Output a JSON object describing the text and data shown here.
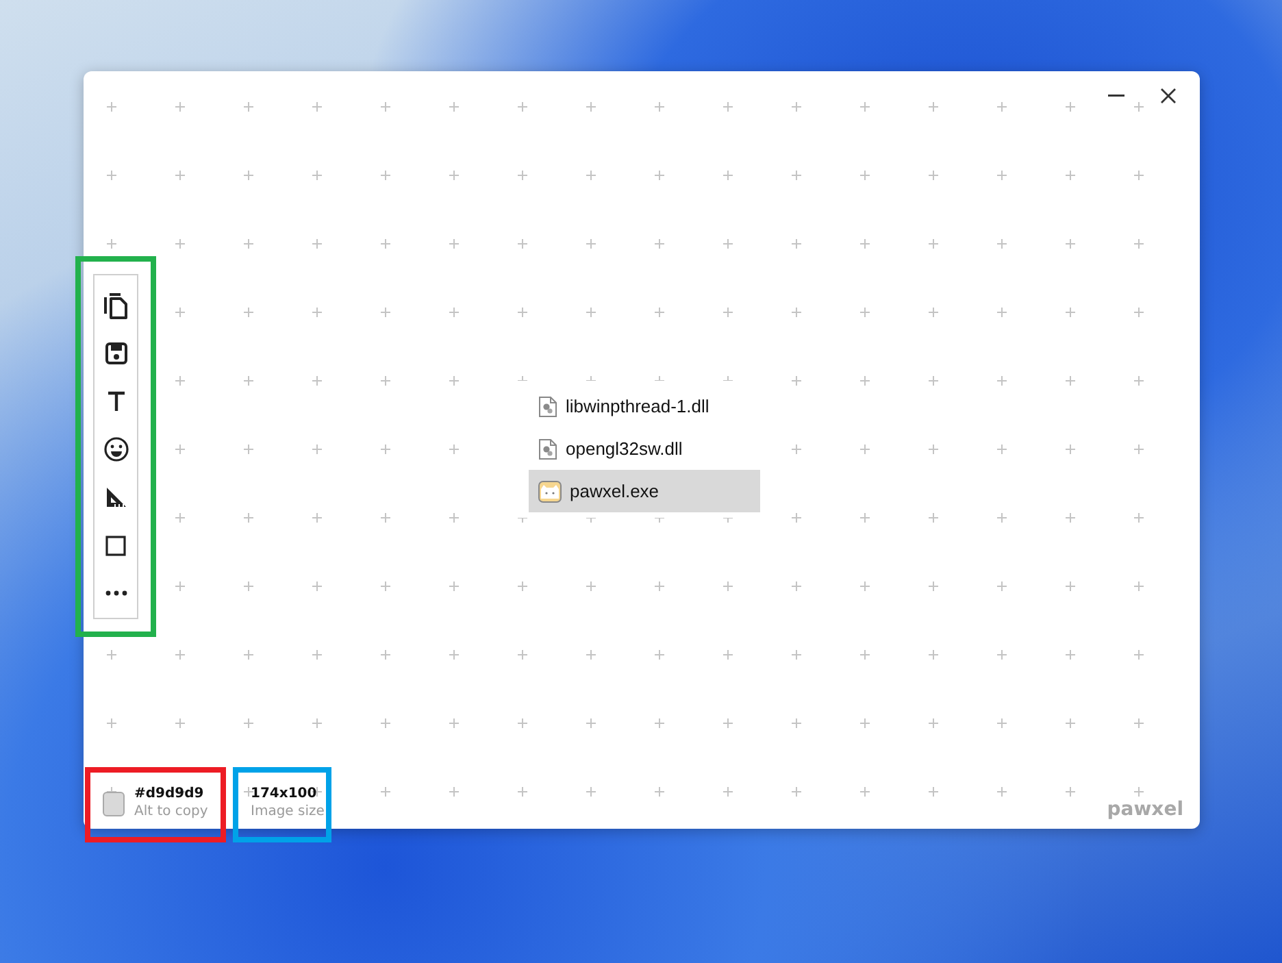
{
  "toolbar": {
    "color": "#22b14c",
    "tools": [
      {
        "kind": "copy"
      },
      {
        "kind": "save"
      },
      {
        "kind": "text"
      },
      {
        "kind": "emoji"
      },
      {
        "kind": "ruler"
      },
      {
        "kind": "rectangle"
      },
      {
        "kind": "more"
      }
    ]
  },
  "file_list": [
    {
      "name": "libwinpthread-1.dll",
      "kind": "dll",
      "selected": false
    },
    {
      "name": "opengl32sw.dll",
      "kind": "dll",
      "selected": false
    },
    {
      "name": "pawxel.exe",
      "kind": "exe",
      "selected": true
    }
  ],
  "color_info": {
    "hex": "#d9d9d9",
    "hint": "Alt to copy",
    "color": "#ed1c24"
  },
  "image_info": {
    "size": "174x100",
    "label": "Image size",
    "color": "#00a2e8"
  },
  "brand": "pawxel"
}
